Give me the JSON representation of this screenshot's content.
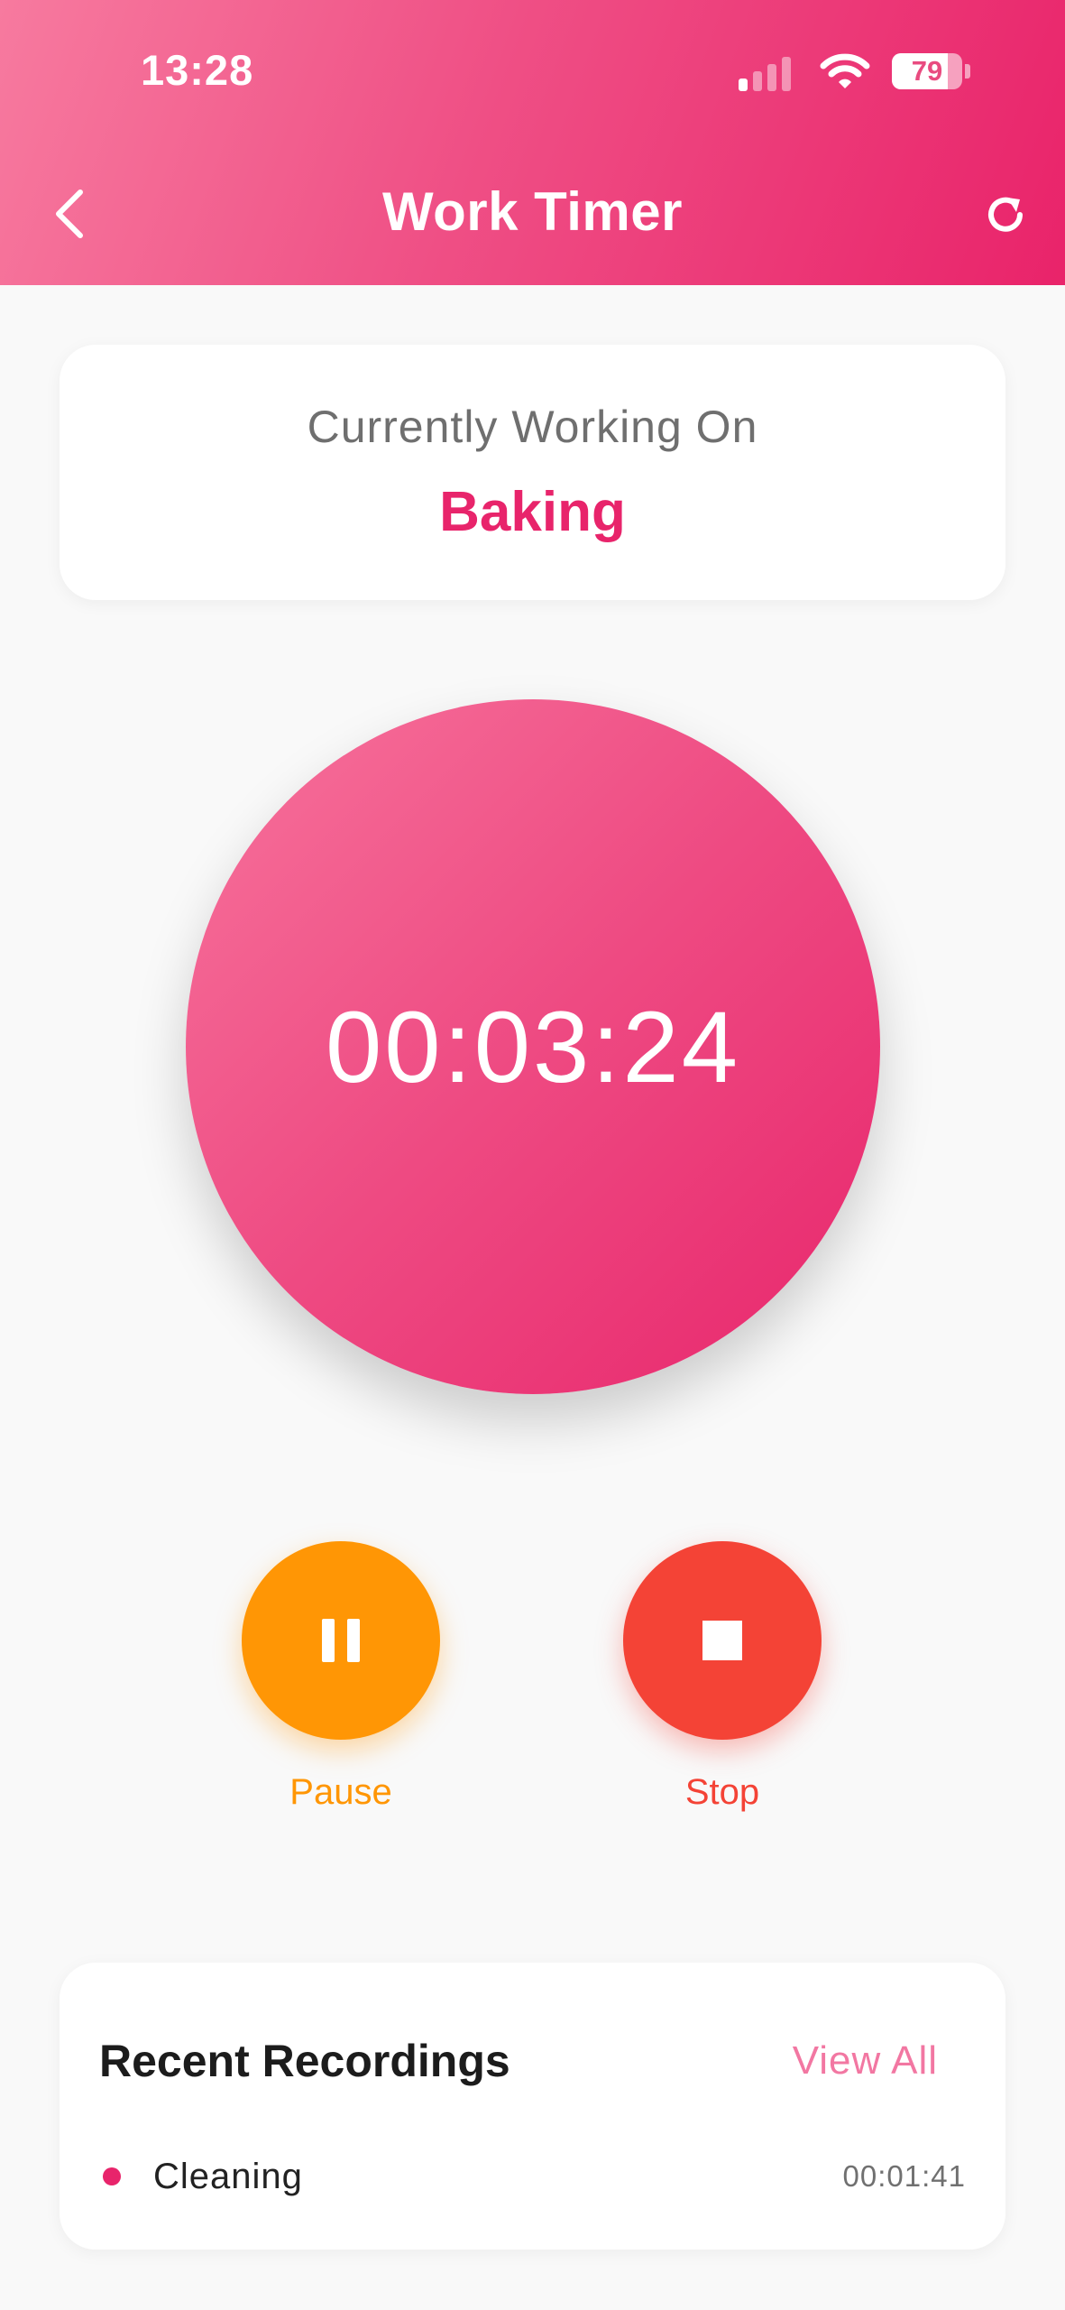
{
  "status_bar": {
    "time": "13:28",
    "battery_level": "79",
    "battery_fraction": 0.79,
    "icons": [
      "signal-icon",
      "wifi-icon",
      "battery-icon"
    ]
  },
  "header": {
    "title": "Work Timer",
    "back_icon": "chevron-left-icon",
    "refresh_icon": "refresh-icon"
  },
  "work": {
    "label": "Currently Working On",
    "task": "Baking"
  },
  "timer": {
    "value": "00:03:24"
  },
  "controls": {
    "pause_label": "Pause",
    "stop_label": "Stop"
  },
  "recent": {
    "title": "Recent Recordings",
    "view_all": "View All",
    "items": [
      {
        "name": "Cleaning",
        "duration": "00:01:41"
      }
    ]
  },
  "colors": {
    "accent": "#e8246b",
    "pause": "#ff9605",
    "stop": "#f44336",
    "view_all": "#f277a2",
    "background": "#f9f9f9"
  }
}
